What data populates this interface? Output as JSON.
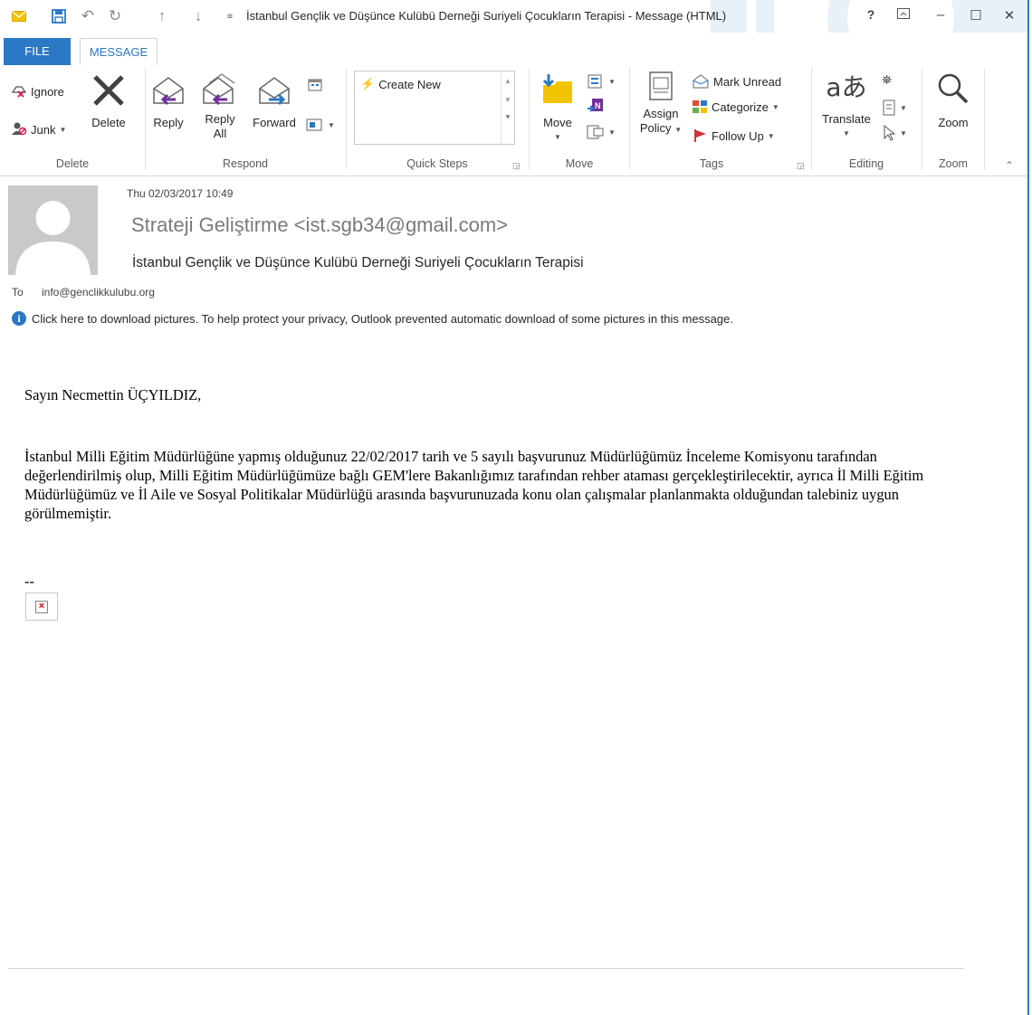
{
  "window": {
    "title": "İstanbul Gençlik ve Düşünce Kulübü Derneği Suriyeli Çocukların Terapisi - Message (HTML)",
    "help": "?",
    "accent_color": "#2b78c4"
  },
  "tabs": {
    "file": "FILE",
    "message": "MESSAGE"
  },
  "ribbon": {
    "delete_group": {
      "ignore": "Ignore",
      "junk": "Junk",
      "delete": "Delete",
      "label": "Delete"
    },
    "respond_group": {
      "reply": "Reply",
      "reply_all_1": "Reply",
      "reply_all_2": "All",
      "forward": "Forward",
      "label": "Respond"
    },
    "quick_steps": {
      "create_new": "Create New",
      "label": "Quick Steps"
    },
    "move_group": {
      "move": "Move",
      "label": "Move"
    },
    "tags_group": {
      "assign_1": "Assign",
      "assign_2": "Policy",
      "mark_unread": "Mark Unread",
      "categorize": "Categorize",
      "follow_up": "Follow Up",
      "label": "Tags"
    },
    "editing_group": {
      "translate": "Translate",
      "label": "Editing"
    },
    "zoom_group": {
      "zoom": "Zoom",
      "label": "Zoom"
    }
  },
  "header": {
    "date": "Thu 02/03/2017 10:49",
    "sender": "Strateji Geliştirme <ist.sgb34@gmail.com>",
    "subject": "İstanbul Gençlik ve Düşünce Kulübü Derneği Suriyeli Çocukların Terapisi",
    "to_label": "To",
    "to_address": "info@genclikkulubu.org",
    "info_message": "Click here to download pictures. To help protect your privacy, Outlook prevented automatic download of some pictures in this message."
  },
  "body": {
    "greeting": "Sayın Necmettin ÜÇYILDIZ,",
    "paragraph": "İstanbul Milli Eğitim Müdürlüğüne yapmış olduğunuz 22/02/2017 tarih ve 5 sayılı başvurunuz Müdürlüğümüz İnceleme Komisyonu tarafından değerlendirilmiş olup, Milli Eğitim Müdürlüğümüze bağlı GEM'lere Bakanlığımız tarafından rehber ataması gerçekleştirilecektir, ayrıca İl Milli Eğitim Müdürlüğümüz ve İl Aile ve Sosyal Politikalar Müdürlüğü arasında başvurunuzada  konu olan çalışmalar planlanmakta olduğundan talebiniz uygun görülmemiştir.",
    "signature_dash": "--"
  }
}
